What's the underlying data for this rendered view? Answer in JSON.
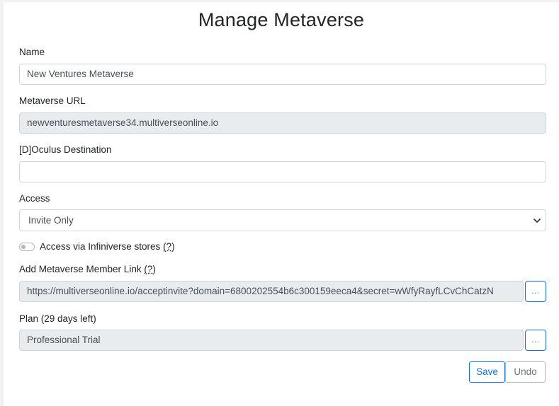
{
  "title": "Manage Metaverse",
  "name": {
    "label": "Name",
    "value": "New Ventures Metaverse"
  },
  "url": {
    "label": "Metaverse URL",
    "value": "newventuresmetaverse34.multiverseonline.io"
  },
  "oculus": {
    "label": "[D]Oculus Destination",
    "value": ""
  },
  "access": {
    "label": "Access",
    "selected": "Invite Only"
  },
  "infiniverse": {
    "label": "Access via Infiniverse stores",
    "help": "(?)",
    "enabled": false
  },
  "member_link": {
    "label": "Add Metaverse Member Link",
    "help": "(?)",
    "value": "https://multiverseonline.io/acceptinvite?domain=6800202554b6c300159eeca4&secret=wWfyRayfLCvChCatzN",
    "button": "..."
  },
  "plan": {
    "label": "Plan (29 days left)",
    "value": "Professional Trial",
    "button": "..."
  },
  "buttons": {
    "save": "Save",
    "undo": "Undo"
  },
  "colors": {
    "primary": "#0d6efd",
    "readonly_bg": "#e9ecef",
    "border": "#ced4da"
  },
  "icons": {
    "select": "chevron-down-icon"
  }
}
